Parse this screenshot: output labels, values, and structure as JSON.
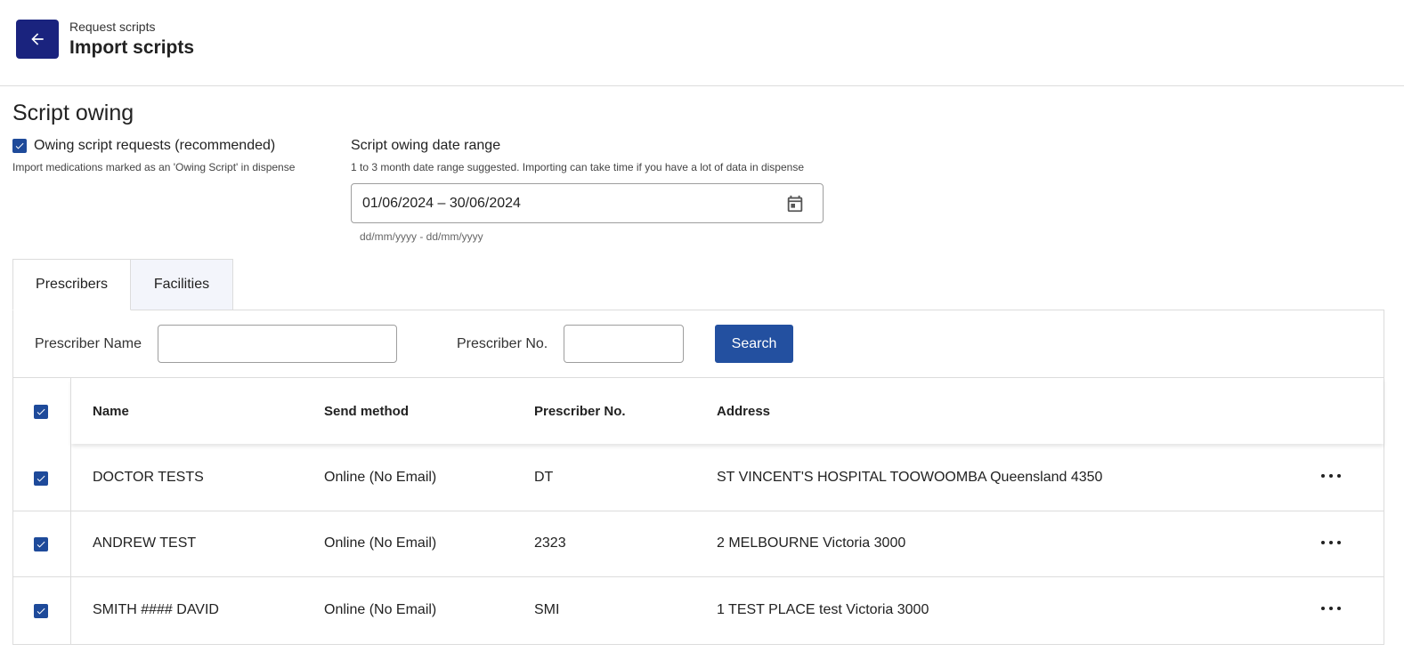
{
  "header": {
    "breadcrumb": "Request scripts",
    "title": "Import scripts"
  },
  "section": {
    "title": "Script owing"
  },
  "owing": {
    "label": "Owing script requests (recommended)",
    "help": "Import medications marked as an 'Owing Script' in dispense",
    "checked": true
  },
  "date_range": {
    "label": "Script owing date range",
    "help": "1 to 3 month date range suggested. Importing can take time if you have a lot of data in dispense",
    "value": "01/06/2024 – 30/06/2024",
    "hint": "dd/mm/yyyy - dd/mm/yyyy"
  },
  "tabs": [
    {
      "label": "Prescribers",
      "active": true
    },
    {
      "label": "Facilities",
      "active": false
    }
  ],
  "search": {
    "name_label": "Prescriber Name",
    "name_value": "",
    "number_label": "Prescriber No.",
    "number_value": "",
    "button_label": "Search"
  },
  "table": {
    "columns": [
      "Name",
      "Send method",
      "Prescriber No.",
      "Address"
    ],
    "rows": [
      {
        "name": "DOCTOR TESTS",
        "send_method": "Online (No Email)",
        "prescriber_no": "DT",
        "address": "ST VINCENT'S HOSPITAL TOOWOOMBA Queensland 4350",
        "checked": true
      },
      {
        "name": "ANDREW TEST",
        "send_method": "Online (No Email)",
        "prescriber_no": "2323",
        "address": "2 MELBOURNE Victoria 3000",
        "checked": true
      },
      {
        "name": "SMITH #### DAVID",
        "send_method": "Online (No Email)",
        "prescriber_no": "SMI",
        "address": "1 TEST PLACE test Victoria 3000",
        "checked": true
      }
    ]
  },
  "colors": {
    "brand_dark": "#1a237e",
    "primary": "#2350a0",
    "checkbox": "#1e4a9a"
  }
}
